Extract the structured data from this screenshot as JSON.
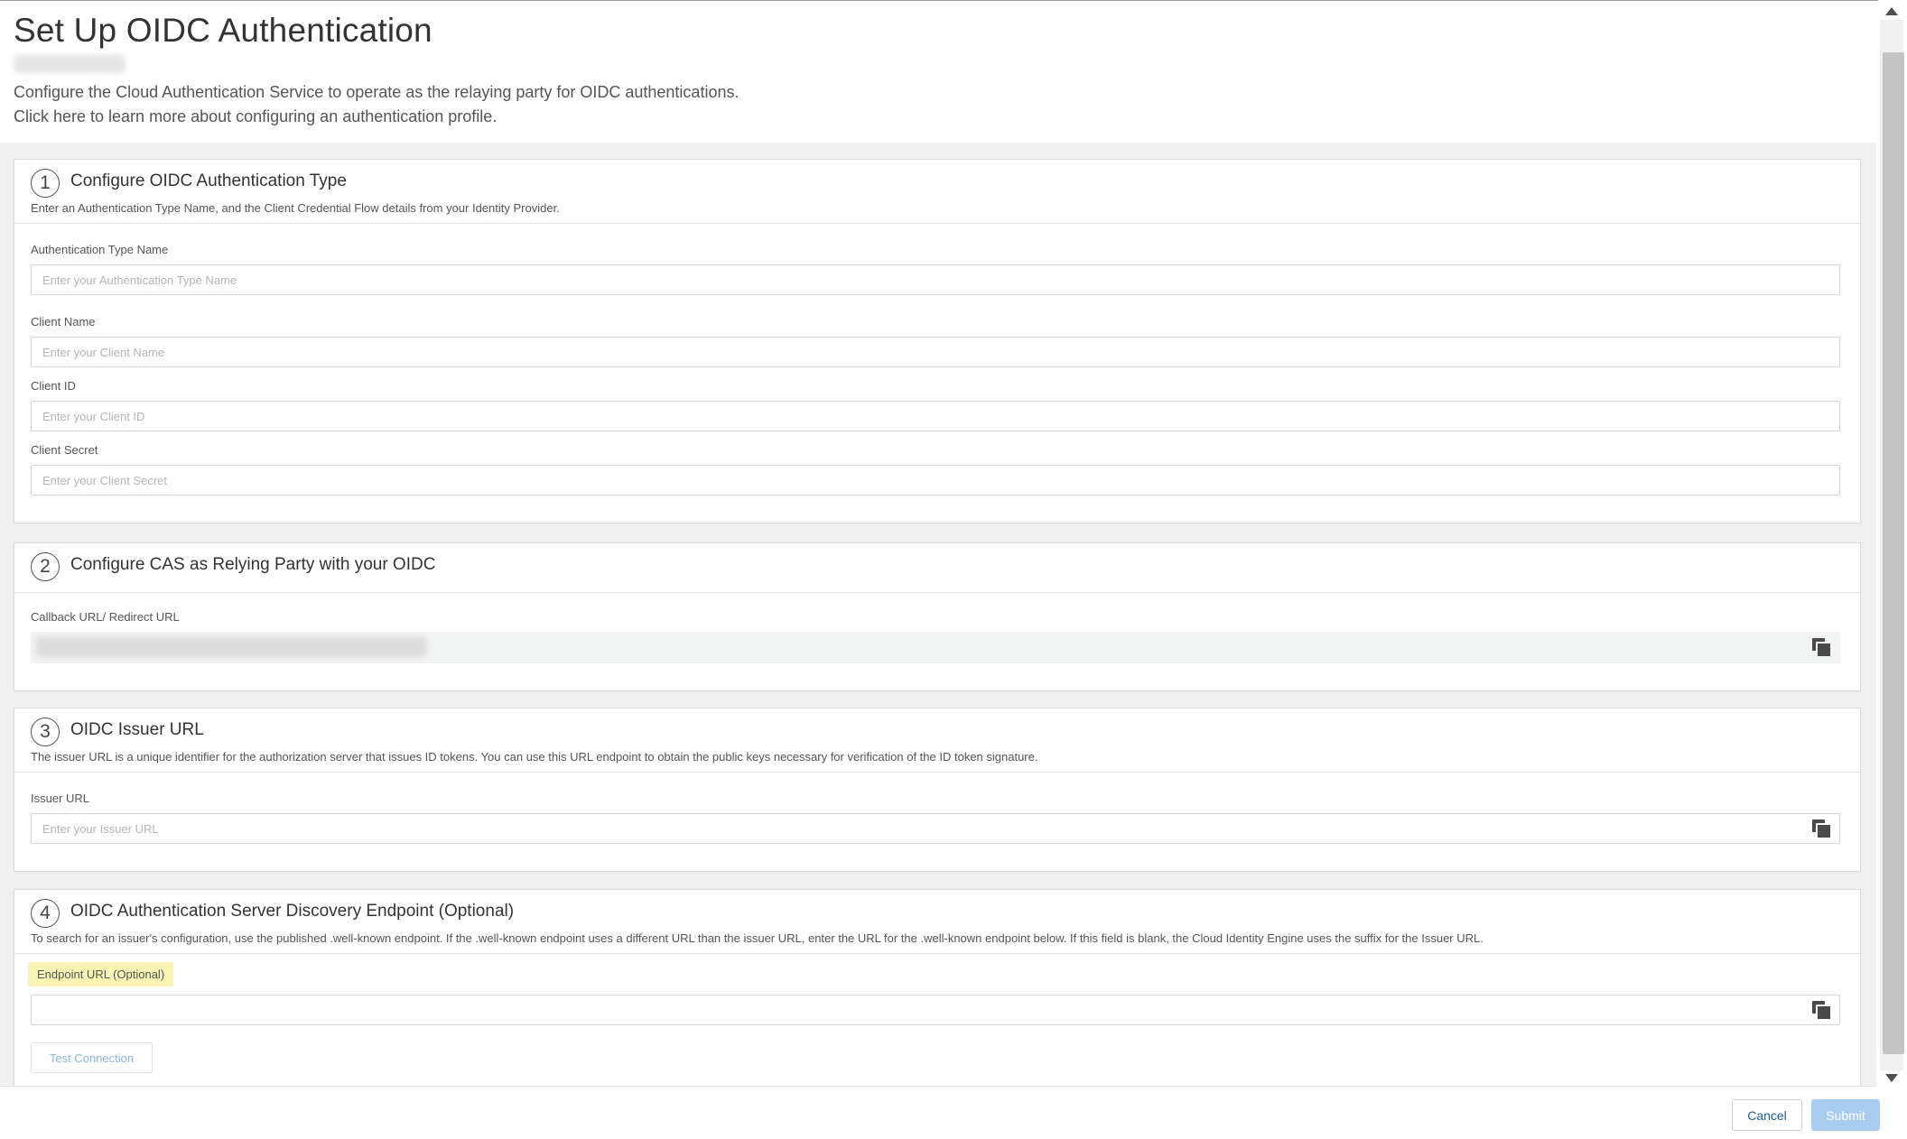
{
  "header": {
    "title": "Set Up OIDC Authentication",
    "intro_line1": "Configure the Cloud Authentication Service to operate as the relaying party for OIDC authentications.",
    "intro_line2": "Click here to learn more about configuring an authentication profile."
  },
  "section1": {
    "number": "1",
    "title": "Configure OIDC Authentication Type",
    "description": "Enter an Authentication Type Name, and the Client Credential Flow details from your Identity Provider.",
    "fields": [
      {
        "label": "Authentication Type Name",
        "placeholder": "Enter your Authentication Type Name",
        "value": ""
      },
      {
        "label": "Client Name",
        "placeholder": "Enter your Client Name",
        "value": ""
      },
      {
        "label": "Client ID",
        "placeholder": "Enter your Client ID",
        "value": ""
      },
      {
        "label": "Client Secret",
        "placeholder": "Enter your Client Secret",
        "value": ""
      }
    ]
  },
  "section2": {
    "number": "2",
    "title": "Configure CAS as Relying Party with your OIDC",
    "field_label": "Callback URL/ Redirect URL"
  },
  "section3": {
    "number": "3",
    "title": "OIDC Issuer URL",
    "description": "The issuer URL is a unique identifier for the authorization server that issues ID tokens. You can use this URL endpoint to obtain the public keys necessary for verification of the ID token signature.",
    "field_label": "Issuer URL",
    "placeholder": "Enter your Issuer URL",
    "value": ""
  },
  "section4": {
    "number": "4",
    "title": "OIDC Authentication Server Discovery Endpoint (Optional)",
    "description": "To search for an issuer's configuration, use the published .well-known endpoint. If the .well-known endpoint uses a different URL than the issuer URL, enter the URL for the .well-known endpoint below. If this field is blank, the Cloud Identity Engine uses the suffix for the Issuer URL.",
    "field_label": "Endpoint URL (Optional)",
    "value": "",
    "test_button_label": "Test Connection"
  },
  "footer": {
    "cancel_label": "Cancel",
    "submit_label": "Submit"
  },
  "colors": {
    "accent_blue": "#1c5d99",
    "submit_disabled": "#a9cdf0",
    "highlight": "#fbf5b5",
    "background": "#f1f1f1"
  },
  "icons": {
    "copy": "copy-icon",
    "scroll_up": "scroll-up-arrow-icon",
    "scroll_down": "scroll-down-arrow-icon"
  }
}
